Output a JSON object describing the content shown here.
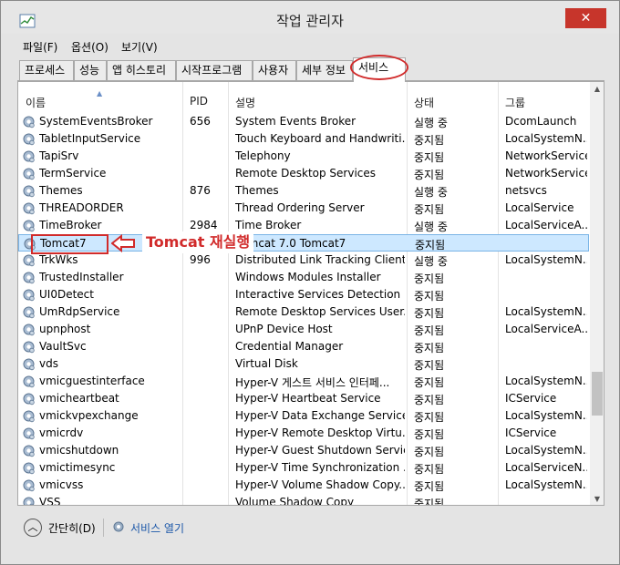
{
  "window": {
    "title": "작업 관리자",
    "close_label": "✕"
  },
  "menu": [
    "파일(F)",
    "옵션(O)",
    "보기(V)"
  ],
  "tabs": [
    "프로세스",
    "성능",
    "앱 히스토리",
    "시작프로그램",
    "사용자",
    "세부 정보",
    "서비스"
  ],
  "active_tab": "서비스",
  "columns": {
    "name": "이름",
    "pid": "PID",
    "desc": "설명",
    "status": "상태",
    "group": "그룹"
  },
  "rows": [
    {
      "name": "SystemEventsBroker",
      "pid": "656",
      "desc": "System Events Broker",
      "status": "실행 중",
      "group": "DcomLaunch"
    },
    {
      "name": "TabletInputService",
      "pid": "",
      "desc": "Touch Keyboard and Handwriti...",
      "status": "중지됨",
      "group": "LocalSystemN..."
    },
    {
      "name": "TapiSrv",
      "pid": "",
      "desc": "Telephony",
      "status": "중지됨",
      "group": "NetworkService"
    },
    {
      "name": "TermService",
      "pid": "",
      "desc": "Remote Desktop Services",
      "status": "중지됨",
      "group": "NetworkService"
    },
    {
      "name": "Themes",
      "pid": "876",
      "desc": "Themes",
      "status": "실행 중",
      "group": "netsvcs"
    },
    {
      "name": "THREADORDER",
      "pid": "",
      "desc": "Thread Ordering Server",
      "status": "중지됨",
      "group": "LocalService"
    },
    {
      "name": "TimeBroker",
      "pid": "2984",
      "desc": "Time Broker",
      "status": "실행 중",
      "group": "LocalServiceA..."
    },
    {
      "name": "Tomcat7",
      "pid": "",
      "desc": "Tomcat 7.0 Tomcat7",
      "status": "중지됨",
      "group": ""
    },
    {
      "name": "TrkWks",
      "pid": "996",
      "desc": "Distributed Link Tracking Client",
      "status": "실행 중",
      "group": "LocalSystemN..."
    },
    {
      "name": "TrustedInstaller",
      "pid": "",
      "desc": "Windows Modules Installer",
      "status": "중지됨",
      "group": ""
    },
    {
      "name": "UI0Detect",
      "pid": "",
      "desc": "Interactive Services Detection",
      "status": "중지됨",
      "group": ""
    },
    {
      "name": "UmRdpService",
      "pid": "",
      "desc": "Remote Desktop Services User...",
      "status": "중지됨",
      "group": "LocalSystemN..."
    },
    {
      "name": "upnphost",
      "pid": "",
      "desc": "UPnP Device Host",
      "status": "중지됨",
      "group": "LocalServiceA..."
    },
    {
      "name": "VaultSvc",
      "pid": "",
      "desc": "Credential Manager",
      "status": "중지됨",
      "group": ""
    },
    {
      "name": "vds",
      "pid": "",
      "desc": "Virtual Disk",
      "status": "중지됨",
      "group": ""
    },
    {
      "name": "vmicguestinterface",
      "pid": "",
      "desc": "Hyper-V 게스트 서비스 인터페...",
      "status": "중지됨",
      "group": "LocalSystemN..."
    },
    {
      "name": "vmicheartbeat",
      "pid": "",
      "desc": "Hyper-V Heartbeat Service",
      "status": "중지됨",
      "group": "ICService"
    },
    {
      "name": "vmickvpexchange",
      "pid": "",
      "desc": "Hyper-V Data Exchange Service",
      "status": "중지됨",
      "group": "LocalSystemN..."
    },
    {
      "name": "vmicrdv",
      "pid": "",
      "desc": "Hyper-V Remote Desktop Virtu...",
      "status": "중지됨",
      "group": "ICService"
    },
    {
      "name": "vmicshutdown",
      "pid": "",
      "desc": "Hyper-V Guest Shutdown Service",
      "status": "중지됨",
      "group": "LocalSystemN..."
    },
    {
      "name": "vmictimesync",
      "pid": "",
      "desc": "Hyper-V Time Synchronization ...",
      "status": "중지됨",
      "group": "LocalServiceN..."
    },
    {
      "name": "vmicvss",
      "pid": "",
      "desc": "Hyper-V Volume Shadow Copy...",
      "status": "중지됨",
      "group": "LocalSystemN..."
    },
    {
      "name": "VSS",
      "pid": "",
      "desc": "Volume Shadow Copy",
      "status": "중지됨",
      "group": ""
    }
  ],
  "selected_row": "Tomcat7",
  "annotation": {
    "text": "Tomcat 재실행",
    "color": "#d12b2b"
  },
  "footer": {
    "collapse_label": "간단히(D)",
    "open_services_label": "서비스 열기"
  },
  "colors": {
    "selection": "#cde8ff",
    "close_button": "#c7352b",
    "annotation": "#d12b2b"
  }
}
